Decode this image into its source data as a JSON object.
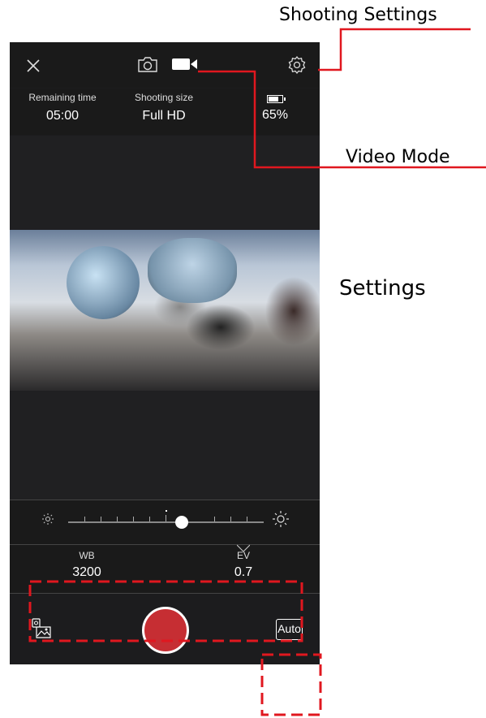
{
  "annotations": {
    "shooting_settings": "Shooting Settings",
    "video_mode": "Video Mode",
    "settings": "Settings"
  },
  "topbar": {
    "icons": [
      "close-icon",
      "camera-icon",
      "video-camera-icon",
      "gear-icon"
    ]
  },
  "info": {
    "remaining_label": "Remaining time",
    "remaining_value": "05:00",
    "size_label": "Shooting size",
    "size_value": "Full HD",
    "battery_value": "65%"
  },
  "params": {
    "wb_label": "WB",
    "wb_value": "3200",
    "ev_label": "EV",
    "ev_value": "0.7"
  },
  "controls": {
    "auto_label": "Auto",
    "exposure_slider_level": 0.58
  },
  "colors": {
    "annotation_red": "#e0171f",
    "shutter_red": "#c62e33",
    "app_bg": "#1c1c1e"
  }
}
